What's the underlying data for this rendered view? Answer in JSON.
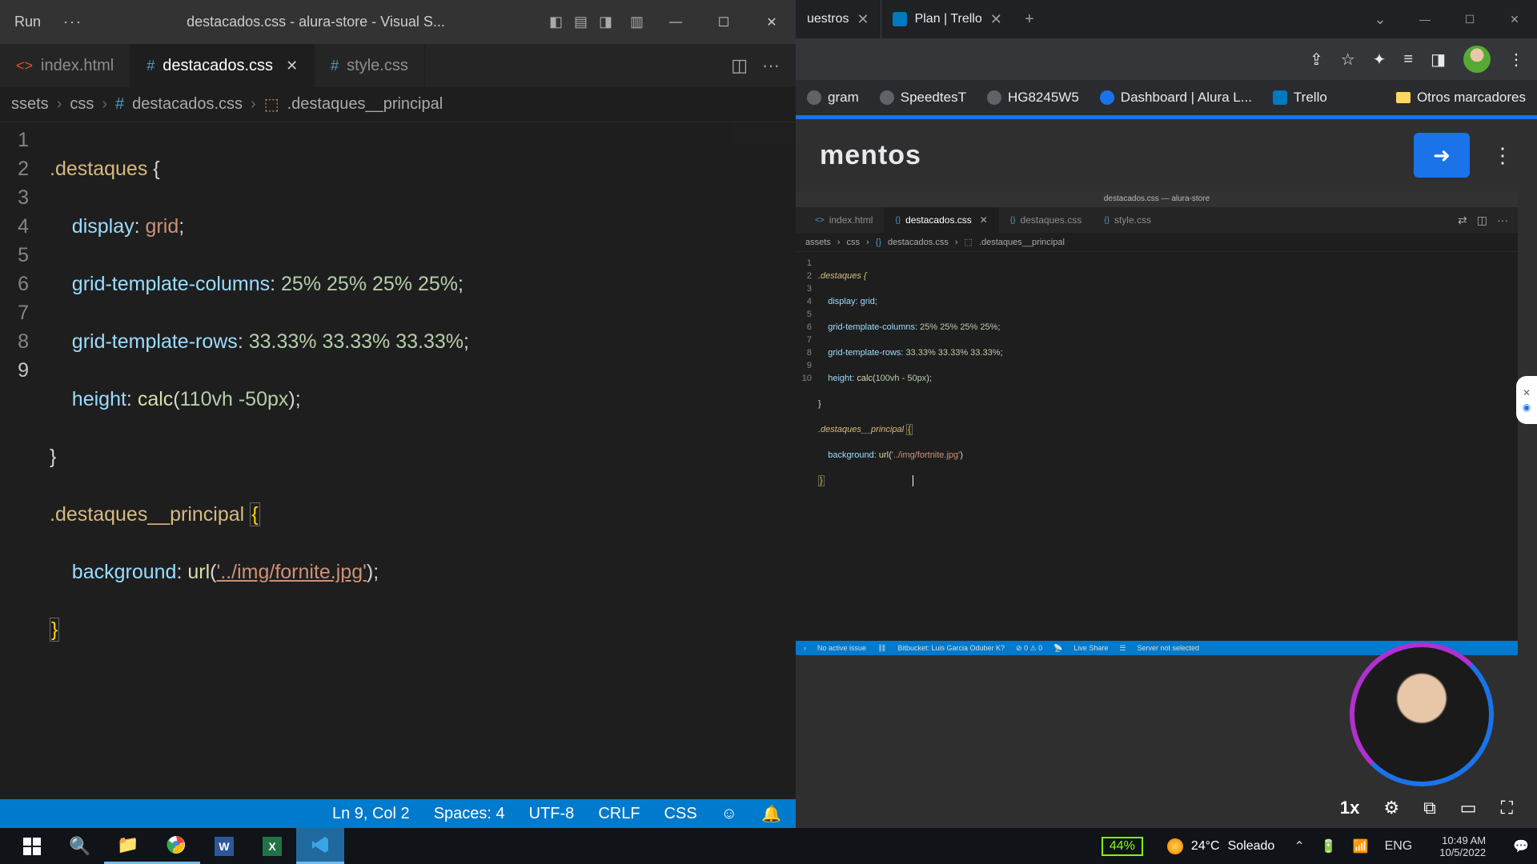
{
  "vscode": {
    "menu": {
      "run": "Run",
      "more": "···"
    },
    "title": "destacados.css - alura-store - Visual S...",
    "tabs": [
      {
        "label": "index.html",
        "type": "html"
      },
      {
        "label": "destacados.css",
        "type": "css",
        "active": true
      },
      {
        "label": "style.css",
        "type": "css"
      }
    ],
    "breadcrumb": [
      "ssets",
      "css",
      "destacados.css",
      ".destaques__principal"
    ],
    "code": {
      "sel1": ".destaques",
      "prop": {
        "display": "display",
        "gtc": "grid-template-columns",
        "gtr": "grid-template-rows",
        "height": "height",
        "bg": "background"
      },
      "val": {
        "grid": "grid",
        "gtc": "25% 25% 25% 25%",
        "gtr": "33.33% 33.33% 33.33%",
        "calc": "calc",
        "h1": "110vh",
        "h2": "-50px"
      },
      "sel2": ".destaques__principal",
      "url": "url",
      "imgpath": "'../img/fornite.jpg'"
    },
    "status": {
      "pos": "Ln 9, Col 2",
      "spaces": "Spaces: 4",
      "enc": "UTF-8",
      "eol": "CRLF",
      "lang": "CSS"
    }
  },
  "chrome": {
    "tabs": [
      {
        "label": "uestros"
      },
      {
        "label": "Plan | Trello",
        "trello": true
      }
    ],
    "bookmarks": [
      {
        "l": "gram"
      },
      {
        "l": "SpeedtesT"
      },
      {
        "l": "HG8245W5"
      },
      {
        "l": "Dashboard | Alura L..."
      },
      {
        "l": "Trello"
      }
    ],
    "otherbm": "Otros marcadores",
    "page": {
      "heading": "mentos"
    },
    "mini": {
      "title": "destacados.css — alura-store",
      "tabs": [
        {
          "l": "index.html"
        },
        {
          "l": "destacados.css",
          "a": true
        },
        {
          "l": "destaques.css"
        },
        {
          "l": "style.css"
        }
      ],
      "bc": [
        "assets",
        "css",
        "destacados.css",
        ".destaques__principal"
      ],
      "lines": {
        "l1": ".destaques {",
        "l2": "    display: grid;",
        "l3": "    grid-template-columns: 25% 25% 25% 25%;",
        "l4": "    grid-template-rows: 33.33% 33.33% 33.33%;",
        "l5": "    height: calc(100vh - 50px);",
        "l6": "}",
        "l7": ".destaques__principal {",
        "l8": "    background: url('../img/fortnite.jpg')",
        "l9": "}"
      },
      "status": [
        "No active issue",
        "Bitbucket: Luis Garcia Oduber K?",
        "⊘ 0 ⚠ 0",
        "Live Share",
        "Server not selected"
      ]
    },
    "video": {
      "speed": "1x"
    }
  },
  "taskbar": {
    "battery": "44%",
    "weather": {
      "temp": "24°C",
      "cond": "Soleado"
    },
    "lang": "ENG",
    "time": "10:49 AM",
    "date": "10/5/2022"
  }
}
